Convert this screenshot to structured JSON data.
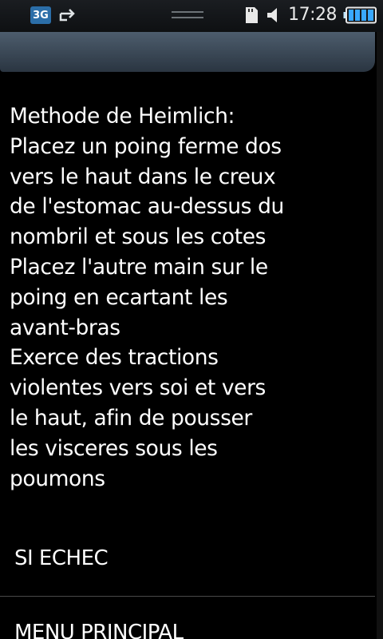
{
  "status_bar": {
    "network_label": "3G",
    "time": "17:28",
    "icons": [
      "3g-icon",
      "sync-icon",
      "drag-handle",
      "sd-card-icon",
      "volume-icon",
      "battery-icon"
    ]
  },
  "content": {
    "text": "Methode de Heimlich:\nPlacez un poing ferme dos\n vers le haut dans le creux\nde l'estomac au-dessus du\n nombril et sous les cotes\nPlacez l'autre main sur le\npoing en ecartant les\navant-bras\nExerce des tractions\nviolentes vers soi et vers\nle haut, afin de pousser\nles visceres sous les\npoumons"
  },
  "menu": {
    "si_echec": "SI ECHEC",
    "menu_principal": "MENU PRINCIPAL"
  }
}
